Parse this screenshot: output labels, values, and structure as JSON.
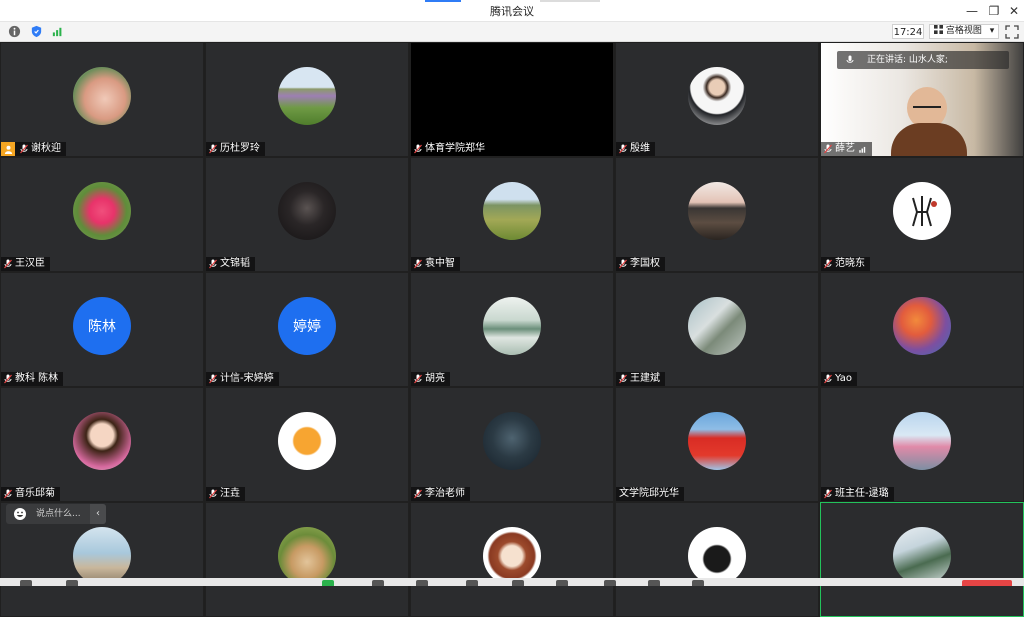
{
  "window": {
    "title": "腾讯会议",
    "minimize": "—",
    "restore": "❐",
    "close": "✕"
  },
  "toolbar": {
    "icons": [
      "info-icon",
      "shield-icon",
      "signal-icon"
    ],
    "time": "17:24",
    "view_label": "宫格视图",
    "view_dropdown": "▾"
  },
  "speaking": {
    "label": "正在讲话: 山水人家;"
  },
  "chat": {
    "placeholder": "说点什么...",
    "collapse": "‹"
  },
  "colors": {
    "avatar_blue": "#1e6ff0",
    "host_orange": "#f5a623",
    "active_border": "#23c25b",
    "tile_bg": "#2b2c2e"
  },
  "participants": [
    {
      "name": "谢秋迎",
      "host": true
    },
    {
      "name": "历杜罗玲"
    },
    {
      "name": "体育学院郑华"
    },
    {
      "name": "殷维"
    },
    {
      "name": "薛艺"
    },
    {
      "name": "王汉臣"
    },
    {
      "name": "文锦韬"
    },
    {
      "name": "袁中智"
    },
    {
      "name": "李国权"
    },
    {
      "name": "范晓东"
    },
    {
      "name": "教科 陈林",
      "avatar_text": "陈林"
    },
    {
      "name": "计信-宋婷婷",
      "avatar_text": "婷婷"
    },
    {
      "name": "胡亮"
    },
    {
      "name": "王建斌"
    },
    {
      "name": "Yao"
    },
    {
      "name": "音乐邱菊"
    },
    {
      "name": "汪垚"
    },
    {
      "name": "李治老师"
    },
    {
      "name": "文学院邱光华"
    },
    {
      "name": "班主任-逯璐"
    }
  ]
}
